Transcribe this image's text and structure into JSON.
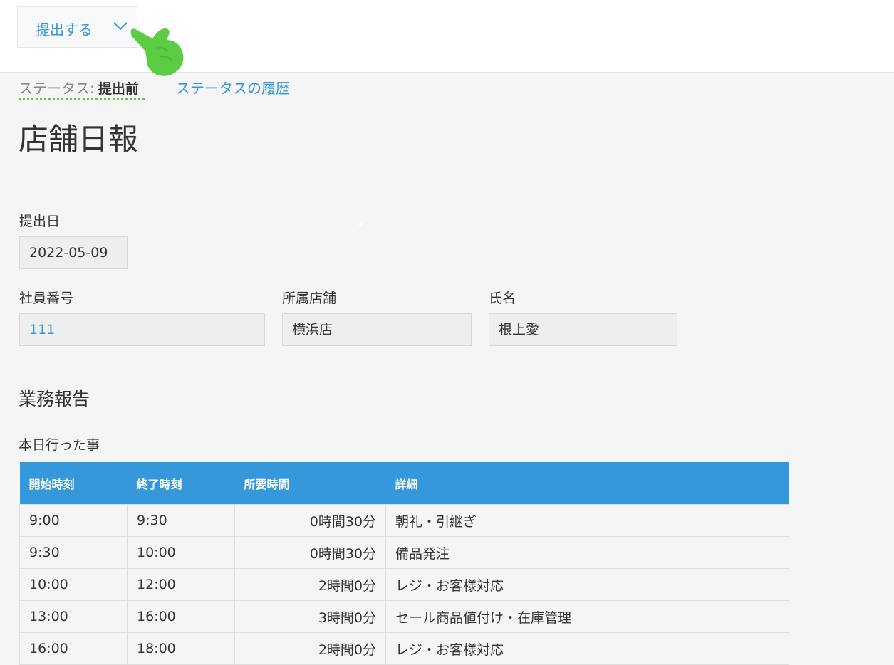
{
  "toolbar": {
    "action_label": "提出する"
  },
  "status": {
    "prefix": "ステータス:",
    "value": "提出前",
    "history_link": "ステータスの履歴"
  },
  "page": {
    "title": "店舗日報"
  },
  "fields": {
    "submit_date": {
      "label": "提出日",
      "value": "2022-05-09"
    },
    "employee_number": {
      "label": "社員番号",
      "value": "111"
    },
    "store": {
      "label": "所属店舗",
      "value": "横浜店"
    },
    "name": {
      "label": "氏名",
      "value": "根上愛"
    }
  },
  "report": {
    "section_title": "業務報告",
    "table_label": "本日行った事",
    "columns": [
      "開始時刻",
      "終了時刻",
      "所要時間",
      "詳細"
    ],
    "rows": [
      {
        "start": "9:00",
        "end": "9:30",
        "duration": "0時間30分",
        "detail": "朝礼・引継ぎ"
      },
      {
        "start": "9:30",
        "end": "10:00",
        "duration": "0時間30分",
        "detail": "備品発注"
      },
      {
        "start": "10:00",
        "end": "12:00",
        "duration": "2時間0分",
        "detail": "レジ・お客様対応"
      },
      {
        "start": "13:00",
        "end": "16:00",
        "duration": "3時間0分",
        "detail": "セール商品値付け・在庫管理"
      },
      {
        "start": "16:00",
        "end": "18:00",
        "duration": "2時間0分",
        "detail": "レジ・お客様対応"
      }
    ]
  },
  "colors": {
    "accent": "#3498db",
    "status_underline": "#5ccc45",
    "pointer": "#5ccc45"
  },
  "icons": {
    "dropdown": "chevron-down-icon",
    "pointer": "pointing-hand-icon"
  }
}
